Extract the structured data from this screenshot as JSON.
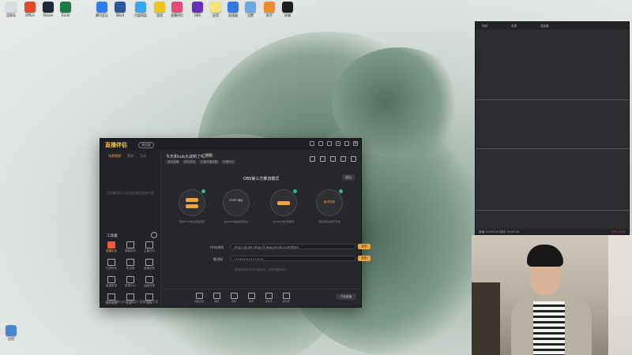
{
  "desktop": {
    "icons": [
      {
        "label": "回收站",
        "color": "#d8dde2"
      },
      {
        "label": "Office",
        "color": "#e04a2a"
      },
      {
        "label": "Steam",
        "color": "#1b2838"
      },
      {
        "label": "Excel",
        "color": "#1e7a44"
      },
      {
        "label": "腾讯会议",
        "color": "#2e7cf6"
      },
      {
        "label": "Word",
        "color": "#2b579a"
      },
      {
        "label": "百度网盘",
        "color": "#3aa7f2"
      },
      {
        "label": "游戏",
        "color": "#f0c419"
      },
      {
        "label": "直播伴侣",
        "color": "#e44a7a"
      },
      {
        "label": "OBS",
        "color": "#6b2fbf"
      },
      {
        "label": "应用",
        "color": "#f5e37a"
      },
      {
        "label": "加速器",
        "color": "#2f7be8"
      },
      {
        "label": "设置",
        "color": "#6aa7e4"
      },
      {
        "label": "助手",
        "color": "#f08a2a"
      },
      {
        "label": "终端",
        "color": "#1c1c1c"
      }
    ],
    "bottom_icon": {
      "label": "应用",
      "color": "#4a86d0"
    }
  },
  "app": {
    "brand": "直播伴侣",
    "version": "测试版",
    "left_tabs": [
      "场景管理",
      "素材",
      "互动"
    ],
    "empty_text": "添加素材后可在此处管理直播内容",
    "tools_title": "工具箱",
    "tools": [
      "直播玩法",
      "弹幕助手",
      "主播任务",
      "礼物特效",
      "粉丝团",
      "直播回放",
      "直播数据",
      "数据中心",
      "高级设置",
      "商品管理",
      "连线PK",
      "更多"
    ],
    "status_text": "本次开播时长00:00:00 直播状态正常",
    "live_title": "今天和sub大战到了吗~",
    "live_badge": "修改",
    "tags": [
      "游戏直播",
      "单机游戏",
      "主播开播设置",
      "开播时长"
    ],
    "stage_title": "OBS第三方推流模式",
    "exit_label": "退出",
    "steps": [
      {
        "label": "开始直播",
        "caption": "复制RTMP地址和推流码"
      },
      {
        "label": "RTMP 地址",
        "caption": "在OBS中粘贴推流地址"
      },
      {
        "label": "开始推流",
        "caption": "在OBS点击开始推流"
      },
      {
        "label": "推流完成",
        "caption": "推流成功后即可开播"
      }
    ],
    "rtmp_label": "rtmp地址",
    "rtmp_value": "rtmp://push-rtmp-l3.douyincdn.com/third",
    "key_label": "推流码",
    "key_value": "••••••••••••••••",
    "copy_label": "复制",
    "hint": "推流码仅在本次开播有效，请勿泄露给他人",
    "bottom_buttons": [
      "直播互动",
      "美颜",
      "音效",
      "弹幕",
      "麦克风",
      "扬声器"
    ],
    "golive_label": "开始直播",
    "footer": [
      "CPU",
      "内存",
      "帧率",
      "码率"
    ]
  },
  "rpanel": {
    "header": [
      "场景",
      "来源",
      "混音器"
    ],
    "footer_left": "直播: 00:00:00  录制: 00:00:00",
    "footer_right": "CPU: 2.0%"
  }
}
